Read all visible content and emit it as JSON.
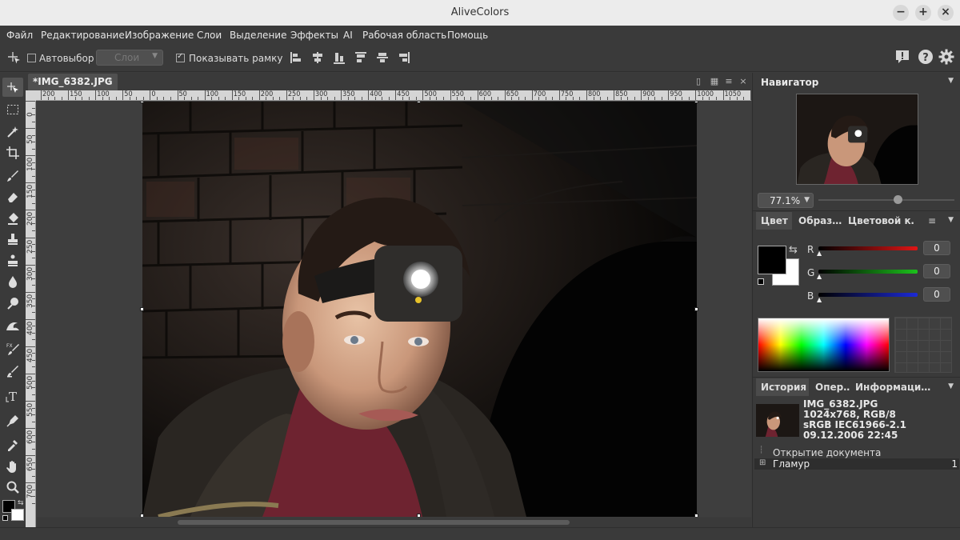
{
  "app": {
    "title": "AliveColors",
    "window_controls": [
      "−",
      "+",
      "×"
    ]
  },
  "menu": [
    "Файл",
    "Редактирование",
    "Изображение",
    "Слои",
    "Выделение",
    "Эффекты",
    "AI",
    "Рабочая область",
    "Помощь"
  ],
  "options": {
    "autoselect_label": "Автовыбор",
    "autoselect_checked": false,
    "layer_combo": "Слои",
    "show_frame_label": "Показывать рамку",
    "show_frame_checked": true
  },
  "document": {
    "tab_label": "*IMG_6382.JPG",
    "tab_close": "×",
    "hruler_labels": [
      "200",
      "150",
      "100",
      "50",
      "0",
      "50",
      "100",
      "150",
      "200",
      "250",
      "300",
      "350",
      "400",
      "450",
      "500",
      "550",
      "600",
      "650",
      "700",
      "750",
      "800",
      "850",
      "900",
      "950",
      "1000",
      "1050",
      "1100"
    ],
    "vruler_labels": [
      "0",
      "50",
      "100",
      "150",
      "200",
      "250",
      "300",
      "350",
      "400",
      "450",
      "500",
      "550",
      "600",
      "650",
      "700"
    ]
  },
  "navigator": {
    "title": "Навигатор",
    "zoom": "77.1%",
    "zoom_slider_fraction": 0.58
  },
  "color_panel": {
    "tabs": [
      "Цвет",
      "Образ…",
      "Цветовой к…"
    ],
    "channels": [
      {
        "label": "R",
        "value": "0",
        "color": "#d21c1c"
      },
      {
        "label": "G",
        "value": "0",
        "color": "#1cbe1c"
      },
      {
        "label": "B",
        "value": "0",
        "color": "#1c2ad2"
      }
    ],
    "foreground": "#000000",
    "background": "#ffffff"
  },
  "history_panel": {
    "tabs": [
      "История",
      "Опер…",
      "Информаци…"
    ],
    "file_name": "IMG_6382.JPG",
    "file_size": "1024x768, RGB/8",
    "profile": "sRGB IEC61966-2.1",
    "date": "09.12.2006 22:45",
    "items": [
      {
        "label": "Открытие документа",
        "count": ""
      },
      {
        "label": "Гламур",
        "count": "1"
      }
    ]
  }
}
